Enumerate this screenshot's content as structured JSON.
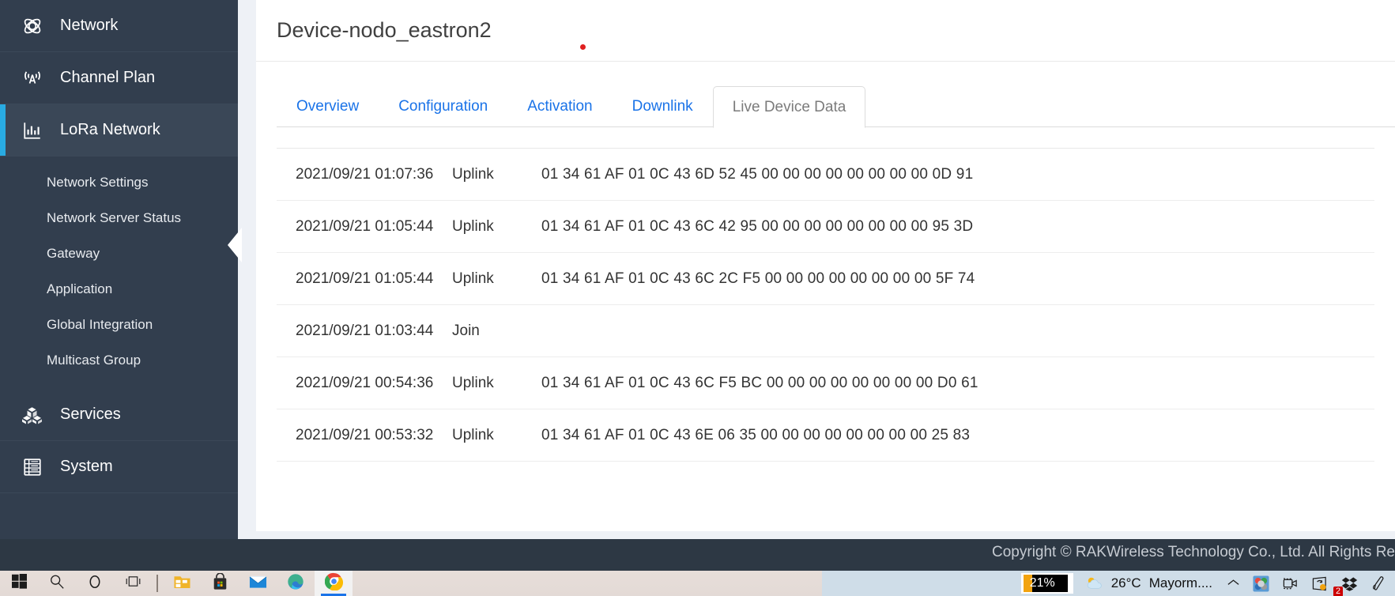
{
  "sidebar": {
    "items": [
      {
        "label": "Network",
        "icon": "network-globe-icon",
        "active": false
      },
      {
        "label": "Channel Plan",
        "icon": "antenna-icon",
        "active": false
      },
      {
        "label": "LoRa Network",
        "icon": "bar-chart-icon",
        "active": true
      },
      {
        "label": "Services",
        "icon": "cubes-icon",
        "active": false
      },
      {
        "label": "System",
        "icon": "list-panel-icon",
        "active": false
      }
    ],
    "sub_items": [
      "Network Settings",
      "Network Server Status",
      "Gateway",
      "Application",
      "Global Integration",
      "Multicast Group"
    ],
    "accent_color": "#29abe2",
    "background_color": "#323e4e"
  },
  "header": {
    "title": "Device-nodo_eastron2",
    "status_dot_color": "#e02020"
  },
  "tabs": [
    {
      "label": "Overview",
      "active": false
    },
    {
      "label": "Configuration",
      "active": false
    },
    {
      "label": "Activation",
      "active": false
    },
    {
      "label": "Downlink",
      "active": false
    },
    {
      "label": "Live Device Data",
      "active": true
    }
  ],
  "table": {
    "rows": [
      {
        "time": "2021/09/21 01:07:36",
        "type": "Uplink",
        "data": "01 34 61 AF 01 0C 43 6D 52 45 00 00 00 00 00 00 00 00 0D 91"
      },
      {
        "time": "2021/09/21 01:05:44",
        "type": "Uplink",
        "data": "01 34 61 AF 01 0C 43 6C 42 95 00 00 00 00 00 00 00 00 95 3D"
      },
      {
        "time": "2021/09/21 01:05:44",
        "type": "Uplink",
        "data": "01 34 61 AF 01 0C 43 6C 2C F5 00 00 00 00 00 00 00 00 5F 74"
      },
      {
        "time": "2021/09/21 01:03:44",
        "type": "Join",
        "data": ""
      },
      {
        "time": "2021/09/21 00:54:36",
        "type": "Uplink",
        "data": "01 34 61 AF 01 0C 43 6C F5 BC 00 00 00 00 00 00 00 00 D0 61"
      },
      {
        "time": "2021/09/21 00:53:32",
        "type": "Uplink",
        "data": "01 34 61 AF 01 0C 43 6E 06 35 00 00 00 00 00 00 00 00 25 83"
      }
    ]
  },
  "footer": {
    "copyright": "Copyright © RAKWireless Technology Co., Ltd. All Rights Re"
  },
  "taskbar": {
    "buttons": [
      {
        "name": "start-button",
        "icon": "windows-logo-icon"
      },
      {
        "name": "search-button",
        "icon": "search-icon"
      },
      {
        "name": "cortana-button",
        "icon": "cortana-circle-icon"
      },
      {
        "name": "task-view-button",
        "icon": "task-view-icon"
      }
    ],
    "apps": [
      {
        "name": "file-explorer",
        "icon": "folder-icon",
        "active": false
      },
      {
        "name": "microsoft-store",
        "icon": "store-bag-icon",
        "active": false
      },
      {
        "name": "mail",
        "icon": "mail-envelope-icon",
        "active": false
      },
      {
        "name": "microsoft-edge",
        "icon": "edge-icon",
        "active": false
      },
      {
        "name": "google-chrome",
        "icon": "chrome-icon",
        "active": true
      }
    ],
    "tray": {
      "battery_percent": "21%",
      "battery_level": 21,
      "temperature": "26°C",
      "location": "Mayorm....",
      "show_hidden_label": "⌃",
      "icons": [
        {
          "name": "teamviewer-tray-icon",
          "badge": ""
        },
        {
          "name": "camera-tray-icon",
          "badge": ""
        },
        {
          "name": "screen-share-tray-icon",
          "badge": ""
        },
        {
          "name": "dropbox-tray-icon",
          "badge": "2"
        },
        {
          "name": "pen-tray-icon",
          "badge": ""
        }
      ]
    }
  }
}
